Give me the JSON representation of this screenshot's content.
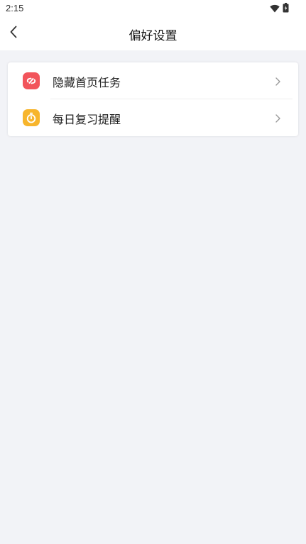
{
  "status_bar": {
    "time": "2:15",
    "icons": [
      "wifi-icon",
      "battery-icon"
    ]
  },
  "header": {
    "title": "偏好设置",
    "back_icon": "chevron-left-icon"
  },
  "settings": {
    "items": [
      {
        "label": "隐藏首页任务",
        "icon": "hide-icon",
        "icon_color": "#f2545b"
      },
      {
        "label": "每日复习提醒",
        "icon": "timer-icon",
        "icon_color": "#f7b52c"
      }
    ]
  },
  "colors": {
    "background": "#f2f3f7",
    "card": "#ffffff",
    "chevron": "#999999"
  }
}
